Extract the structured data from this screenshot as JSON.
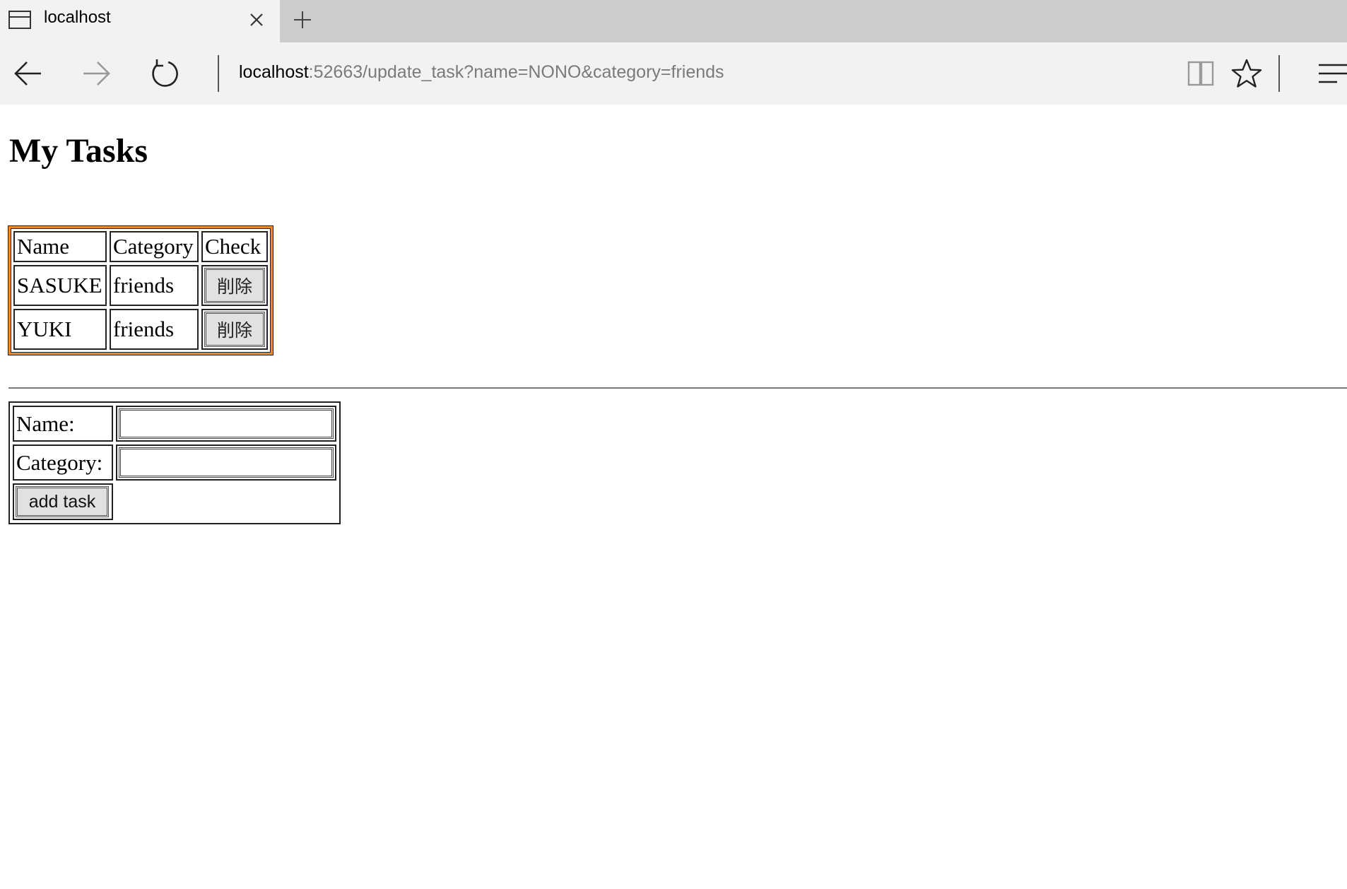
{
  "browser": {
    "tab_title": "localhost",
    "url_host": "localhost",
    "url_rest": ":52663/update_task?name=NONO&category=friends"
  },
  "page": {
    "title": "My Tasks"
  },
  "tasks_table": {
    "border_color": "#f08a25",
    "headers": {
      "name": "Name",
      "category": "Category",
      "check": "Check"
    },
    "rows": [
      {
        "name": "SASUKE",
        "category": "friends",
        "action_label": "削除"
      },
      {
        "name": "YUKI",
        "category": "friends",
        "action_label": "削除"
      }
    ]
  },
  "add_form": {
    "name_label": "Name:",
    "name_value": "",
    "category_label": "Category:",
    "category_value": "",
    "submit_label": "add task"
  },
  "icons": {
    "tab": "tab-page-icon",
    "close": "close-icon",
    "new_tab": "plus-icon",
    "back": "arrow-left-icon",
    "forward": "arrow-right-icon",
    "refresh": "refresh-icon",
    "reading_view": "book-icon",
    "favorite": "star-icon",
    "hub": "menu-lines-icon"
  }
}
